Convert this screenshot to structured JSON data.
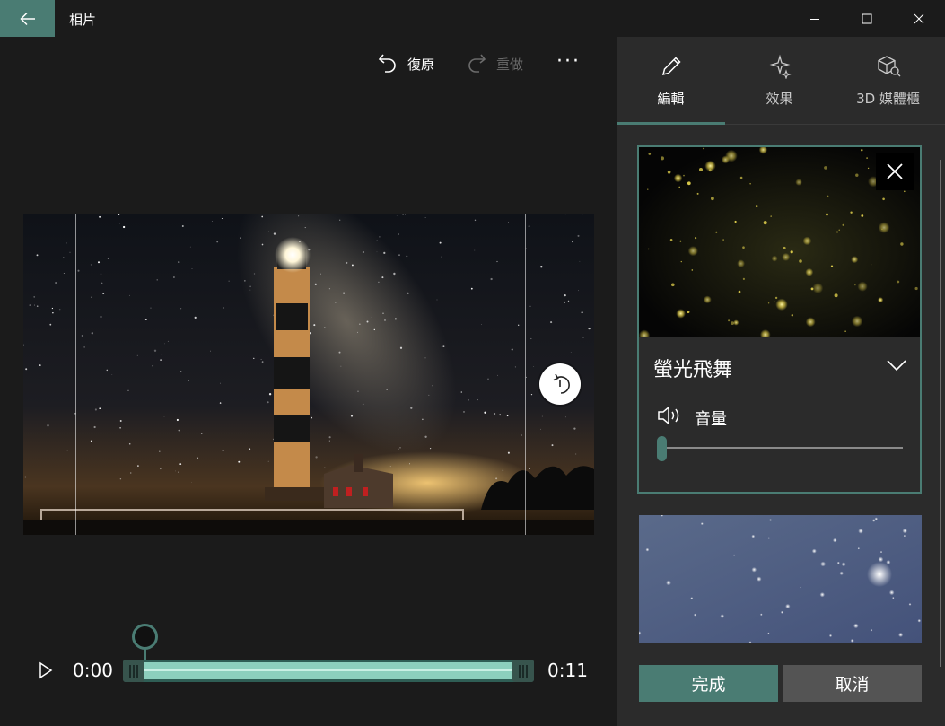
{
  "app": {
    "title": "相片"
  },
  "toolbar": {
    "undo_label": "復原",
    "redo_label": "重做",
    "more_label": "···"
  },
  "timeline": {
    "start_time": "0:00",
    "end_time": "0:11",
    "position_fraction": 0.0
  },
  "panel": {
    "tabs": [
      {
        "label": "編輯",
        "icon": "pencil-icon",
        "selected": true
      },
      {
        "label": "效果",
        "icon": "sparkle-icon",
        "selected": false
      },
      {
        "label": "3D 媒體櫃",
        "icon": "cube-search-icon",
        "selected": false
      }
    ],
    "effect": {
      "name": "螢光飛舞",
      "volume_label": "音量",
      "volume_fraction": 0.0
    },
    "done_label": "完成",
    "cancel_label": "取消"
  },
  "colors": {
    "accent": "#4a7c73",
    "timeline_fill": "#8ccfbd",
    "panel_bg": "#2b2b2b",
    "app_bg": "#1b1b1b"
  }
}
